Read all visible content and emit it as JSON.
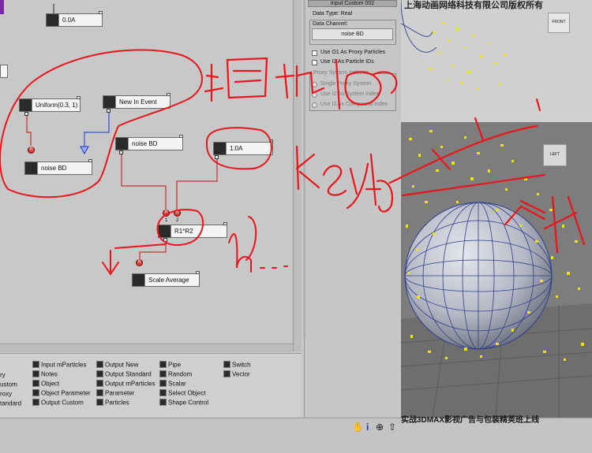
{
  "graph": {
    "nodes": {
      "float_top": "0.0A",
      "uniform": "Uniform(0.3, 1)",
      "new_event": "New In Event",
      "noise_left": "noise BD",
      "noise_mid": "noise BD",
      "float_right": "1.0A",
      "multiply": "R1*R2",
      "scale_avg": "Scale Average"
    },
    "connector_labels": {
      "r": "R",
      "one": "1",
      "two": "2"
    }
  },
  "palette": {
    "col0": [
      "ry",
      "ustom",
      "roxy",
      "tandard"
    ],
    "col1": [
      "Input mParticles",
      "Notes",
      "Object",
      "Object Parameter",
      "Output Custom"
    ],
    "col2": [
      "Output New",
      "Output Standard",
      "Output mParticles",
      "Parameter",
      "Particles"
    ],
    "col3": [
      "Pipe",
      "Random",
      "Scalar",
      "Select Object",
      "Shape Control"
    ],
    "col4": [
      "Switch",
      "Vector"
    ]
  },
  "panel": {
    "rollout_title": "Input Custom 002",
    "data_type": "Data Type: Real",
    "data_channel_label": "Data Channel:",
    "data_channel_value": "noise BD",
    "use_o1": "Use O1 As Proxy Particles",
    "use_i2": "Use I2 As Particle IDs",
    "proxy_group": "Proxy System Indexes",
    "single_proxy": "Single Proxy System",
    "use_system_index": "Use I2 As System Index",
    "use_compound_index": "Use I3 As Compound Index"
  },
  "viewports": {
    "top_cube_label": "FRONT",
    "persp_cube_label": "LEFT"
  },
  "banner": "实战3DMAX影视广告与包装精英班上线",
  "top_banner": "上海动画网络科技有限公司版权所有",
  "handwriting": {
    "chinese_phrase": "随机执行",
    "key_word": "key",
    "m_text": "M..."
  },
  "colors": {
    "annotation": "#e8161b",
    "particles": "#f2e600",
    "sphere": "#2d3f8c"
  }
}
